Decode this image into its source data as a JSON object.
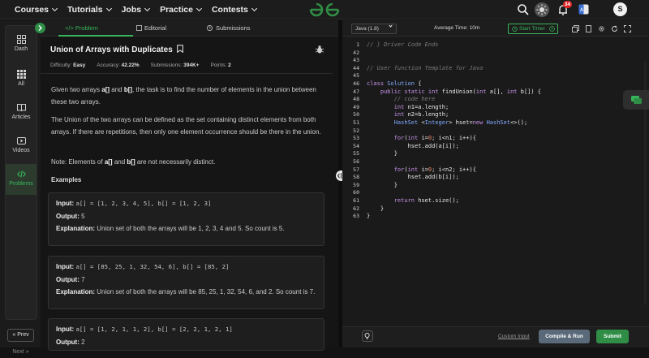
{
  "topnav": {
    "links": [
      "Courses",
      "Tutorials",
      "Jobs",
      "Practice",
      "Contests"
    ],
    "notification_count": "34",
    "avatar_letter": "S"
  },
  "sidebar": {
    "items": [
      {
        "label": "Dash",
        "icon": "grid-icon"
      },
      {
        "label": "All",
        "icon": "apps-icon"
      },
      {
        "label": "Articles",
        "icon": "book-icon"
      },
      {
        "label": "Videos",
        "icon": "video-icon"
      },
      {
        "label": "Problems",
        "icon": "code-icon",
        "active": true
      }
    ],
    "prev_label": "« Prev",
    "next_label": "Next »"
  },
  "problem": {
    "tabs": [
      "</> Problem",
      "Editorial",
      "Submissions"
    ],
    "title": "Union of Arrays with Duplicates",
    "meta": {
      "difficulty_label": "Difficulty:",
      "difficulty": "Easy",
      "accuracy_label": "Accuracy:",
      "accuracy": "42.22%",
      "submissions_label": "Submissions:",
      "submissions": "394K+",
      "points_label": "Points:",
      "points": "2"
    },
    "desc1_a": "Given two arrays ",
    "desc1_b": "a[]",
    "desc1_c": " and ",
    "desc1_d": "b[]",
    "desc1_e": ", the task is to find the number of elements in the union between these two arrays.",
    "desc2": "The Union of the two arrays can be defined as the set containing distinct elements from both arrays. If there are repetitions, then only one element occurrence should be there in the union.",
    "desc3_a": "Note: Elements of ",
    "desc3_b": "a[]",
    "desc3_c": " and ",
    "desc3_d": "b[]",
    "desc3_e": " are not necessarily distinct.",
    "examples_heading": "Examples",
    "input_label": "Input:",
    "output_label": "Output:",
    "explanation_label": "Explanation:",
    "examples": [
      {
        "input": "a[] = [1, 2, 3, 4, 5], b[] = [1, 2, 3]",
        "output": "5",
        "explanation": "Union set of both the arrays will be 1, 2, 3, 4 and 5. So count is 5."
      },
      {
        "input": "a[] = [85, 25, 1, 32, 54, 6], b[] = [85, 2]",
        "output": "7",
        "explanation": "Union set of both the arrays will be 85, 25, 1, 32, 54, 6, and 2. So count is 7."
      },
      {
        "input": "a[] = [1, 2, 1, 1, 2], b[] = [2, 2, 1, 2, 1]",
        "output": "2"
      }
    ]
  },
  "editor": {
    "language": "Java (1.8)",
    "average_time": "Average Time: 10m",
    "start_timer": "Start Timer",
    "line_numbers": [
      "1",
      "42",
      "43",
      "44",
      "45",
      "46",
      "47",
      "48",
      "49",
      "50",
      "51",
      "52",
      "53",
      "54",
      "55",
      "56",
      "57",
      "58",
      "59",
      "60",
      "61",
      "62",
      "63"
    ],
    "lines": [
      "// } Driver Code Ends",
      "",
      "",
      "// User function Template for Java",
      "",
      "class Solution {",
      "    public static int findUnion(int a[], int b[]) {",
      "        // code here",
      "        int n1=a.length;",
      "        int n2=b.length;",
      "        HashSet <Integer> hset=new HashSet<>();",
      "",
      "        for(int i=0; i<n1; i++){",
      "            hset.add(a[i]);",
      "        }",
      "",
      "        for(int i=0; i<n2; i++){",
      "            hset.add(b[i]);",
      "        }",
      "",
      "        return hset.size();",
      "    }",
      "}"
    ],
    "custom_input": "Custom Input",
    "compile_run": "Compile & Run",
    "submit": "Submit"
  },
  "colors": {
    "accent_green": "#2f8d46",
    "active_green": "#37b55a",
    "background": "#131313"
  }
}
